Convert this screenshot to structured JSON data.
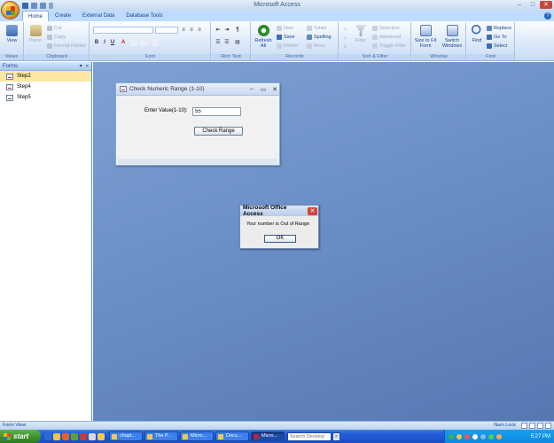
{
  "window": {
    "title": "Microsoft Access",
    "min": "–",
    "max": "□",
    "close": "✕"
  },
  "tabs": [
    "Home",
    "Create",
    "External Data",
    "Database Tools"
  ],
  "ribbon": {
    "views": {
      "view": "View",
      "group": "Views"
    },
    "clipboard": {
      "paste": "Paste",
      "cut": "Cut",
      "copy": "Copy",
      "format_painter": "Format Painter",
      "group": "Clipboard"
    },
    "font": {
      "group": "Font",
      "bold": "B",
      "italic": "I",
      "underline": "U",
      "font_color": "A"
    },
    "rich_text": {
      "group": "Rich Text"
    },
    "records": {
      "refresh": "Refresh All",
      "new": "New",
      "save": "Save",
      "delete": "Delete",
      "totals": "Totals",
      "spelling": "Spelling",
      "more": "More",
      "group": "Records"
    },
    "sort_filter": {
      "filter": "Filter",
      "selection": "Selection",
      "advanced": "Advanced",
      "toggle_filter": "Toggle Filter",
      "group": "Sort & Filter"
    },
    "window": {
      "size_to_fit": "Size to Fit Form",
      "switch_windows": "Switch Windows",
      "group": "Window"
    },
    "find": {
      "find": "Find",
      "replace": "Replace",
      "goto": "Go To",
      "select": "Select",
      "group": "Find"
    }
  },
  "nav": {
    "title": "Forms",
    "items": [
      "Step2",
      "Step4",
      "Step5"
    ]
  },
  "form": {
    "title": "Check Numeric Range (1-10)",
    "label": "Enter Value(1-10):",
    "value": "55",
    "button": "Check Range"
  },
  "msgbox": {
    "title": "Microsoft Office Access",
    "message": "Your number is Out of Range",
    "ok": "OK"
  },
  "status": {
    "left": "Form View",
    "num_lock": "Num Lock"
  },
  "taskbar": {
    "start": "start",
    "tasks": [
      "chapt...",
      "The P...",
      "Micro...",
      "Docu...",
      "Micro..."
    ],
    "search_placeholder": "Search Desktop",
    "clock": "5:27 PM"
  }
}
